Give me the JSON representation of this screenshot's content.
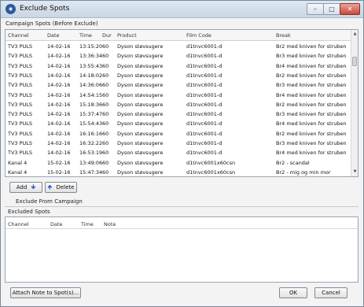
{
  "window": {
    "title": "Exclude Spots",
    "app_icon": "app-logo-icon",
    "controls": {
      "minimize": "–",
      "maximize": "□",
      "close": "✕"
    }
  },
  "campaign": {
    "label": "Campaign Spots  (Before Exclude)",
    "columns": [
      "Channel",
      "Date",
      "Time",
      "Dur",
      "Product",
      "Film Code",
      "Break"
    ],
    "rows": [
      [
        "TV3 PULS",
        "14-02-16",
        "13:15:20",
        "60",
        "Dyson støvsugere",
        "d1tnvc6001-d",
        "Br2 med kniven for struben"
      ],
      [
        "TV3 PULS",
        "14-02-16",
        "13:36:34",
        "60",
        "Dyson støvsugere",
        "d1tnvc6001-d",
        "Br3 med kniven for struben"
      ],
      [
        "TV3 PULS",
        "14-02-16",
        "13:55:43",
        "60",
        "Dyson støvsugere",
        "d1tnvc6001-d",
        "Br4 med kniven for struben"
      ],
      [
        "TV3 PULS",
        "14-02-16",
        "14:18:02",
        "60",
        "Dyson støvsugere",
        "d1tnvc6001-d",
        "Br2 med kniven for struben"
      ],
      [
        "TV3 PULS",
        "14-02-16",
        "14:36:06",
        "60",
        "Dyson støvsugere",
        "d1tnvc6001-d",
        "Br3 med kniven for struben"
      ],
      [
        "TV3 PULS",
        "14-02-16",
        "14:54:15",
        "60",
        "Dyson støvsugere",
        "d1tnvc6001-d",
        "Br4 med kniven for struben"
      ],
      [
        "TV3 PULS",
        "14-02-16",
        "15:18:36",
        "60",
        "Dyson støvsugere",
        "d1tnvc6001-d",
        "Br2 med kniven for struben"
      ],
      [
        "TV3 PULS",
        "14-02-16",
        "15:37:47",
        "60",
        "Dyson støvsugere",
        "d1tnvc6001-d",
        "Br3 med kniven for struben"
      ],
      [
        "TV3 PULS",
        "14-02-16",
        "15:54:43",
        "60",
        "Dyson støvsugere",
        "d1tnvc6001-d",
        "Br4 med kniven for struben"
      ],
      [
        "TV3 PULS",
        "14-02-16",
        "16:16:16",
        "60",
        "Dyson støvsugere",
        "d1tnvc6001-d",
        "Br2 med kniven for struben"
      ],
      [
        "TV3 PULS",
        "14-02-16",
        "16:32:22",
        "60",
        "Dyson støvsugere",
        "d1tnvc6001-d",
        "Br3 med kniven for struben"
      ],
      [
        "TV3 PULS",
        "14-02-16",
        "16:53:19",
        "60",
        "Dyson støvsugere",
        "d1tnvc6001-d",
        "Br4 med kniven for struben"
      ],
      [
        "Kanal 4",
        "15-02-16",
        "13:49:06",
        "60",
        "Dyson støvsugere",
        "d1tnvc6001x60csn",
        "Br2 - scandal"
      ],
      [
        "Kanal 4",
        "15-02-16",
        "15:47:34",
        "60",
        "Dyson støvsugere",
        "d1tnvc6001x60csn",
        "Br2 - mig og min mor"
      ]
    ]
  },
  "buttons": {
    "add": "Add",
    "add_icon": "arrow-down-icon",
    "delete": "Delete",
    "delete_icon": "arrow-up-icon",
    "attach": "Attach Note to Spot(s)...",
    "ok": "OK",
    "cancel": "Cancel"
  },
  "exclude_from_campaign": "Exclude From Campaign",
  "excluded": {
    "label": "Excluded Spots",
    "columns": [
      "Channel",
      "Date",
      "Time",
      "Note"
    ]
  }
}
